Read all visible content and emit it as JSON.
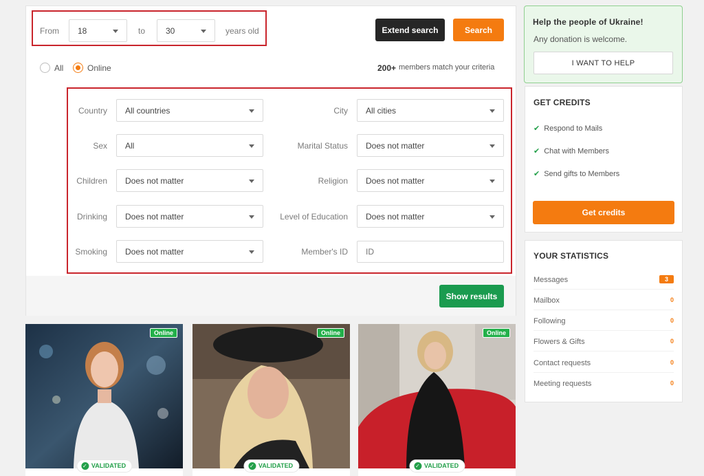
{
  "search": {
    "from_label": "From",
    "age_from": "18",
    "to_label": "to",
    "age_to": "30",
    "years_label": "years old",
    "extend_button": "Extend search",
    "search_button": "Search",
    "radio_all": "All",
    "radio_online": "Online",
    "match_count": "200+",
    "match_text": "members match your criteria",
    "show_results": "Show results"
  },
  "filters": {
    "country": {
      "label": "Country",
      "value": "All countries"
    },
    "city": {
      "label": "City",
      "value": "All cities"
    },
    "sex": {
      "label": "Sex",
      "value": "All"
    },
    "marital": {
      "label": "Marital Status",
      "value": "Does not matter"
    },
    "children": {
      "label": "Children",
      "value": "Does not matter"
    },
    "religion": {
      "label": "Religion",
      "value": "Does not matter"
    },
    "drinking": {
      "label": "Drinking",
      "value": "Does not matter"
    },
    "education": {
      "label": "Level of Education",
      "value": "Does not matter"
    },
    "smoking": {
      "label": "Smoking",
      "value": "Does not matter"
    },
    "member_id": {
      "label": "Member's ID",
      "placeholder": "ID"
    }
  },
  "cards": [
    {
      "online": "Online",
      "validated": "VALIDATED"
    },
    {
      "online": "Online",
      "validated": "VALIDATED"
    },
    {
      "online": "Online",
      "validated": "VALIDATED"
    }
  ],
  "ukraine": {
    "title": "Help the people of Ukraine!",
    "text": "Any donation is welcome.",
    "button": "I WANT TO HELP"
  },
  "credits": {
    "title": "GET CREDITS",
    "items": [
      "Respond to Mails",
      "Chat with Members",
      "Send gifts to Members"
    ],
    "button": "Get credits"
  },
  "stats": {
    "title": "YOUR STATISTICS",
    "rows": [
      {
        "label": "Messages",
        "count": "3"
      },
      {
        "label": "Mailbox",
        "count": "0"
      },
      {
        "label": "Following",
        "count": "0"
      },
      {
        "label": "Flowers & Gifts",
        "count": "0"
      },
      {
        "label": "Contact requests",
        "count": "0"
      },
      {
        "label": "Meeting requests",
        "count": "0"
      }
    ]
  },
  "colors": {
    "accent_orange": "#f47b10",
    "green": "#1a9b4f",
    "highlight_red": "#c9252c",
    "dark_button": "#262626"
  }
}
